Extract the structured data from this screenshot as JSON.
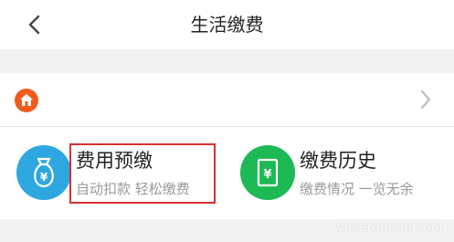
{
  "header": {
    "title": "生活缴费",
    "back_icon": "chevron-left-icon"
  },
  "account": {
    "icon": "house-icon",
    "text": "",
    "chevron_icon": "chevron-right-icon",
    "icon_color": "#ef5a1e"
  },
  "services": [
    {
      "title": "费用预缴",
      "subtitle": "自动扣款 轻松缴费",
      "icon": "money-bag-icon",
      "color": "#2ea7e0",
      "highlighted": true
    },
    {
      "title": "缴费历史",
      "subtitle": "缴费情况 一览无余",
      "icon": "receipt-yen-icon",
      "color": "#1db954"
    }
  ],
  "highlight_color": "#d93030",
  "watermark": "wuyetoutiao.com"
}
